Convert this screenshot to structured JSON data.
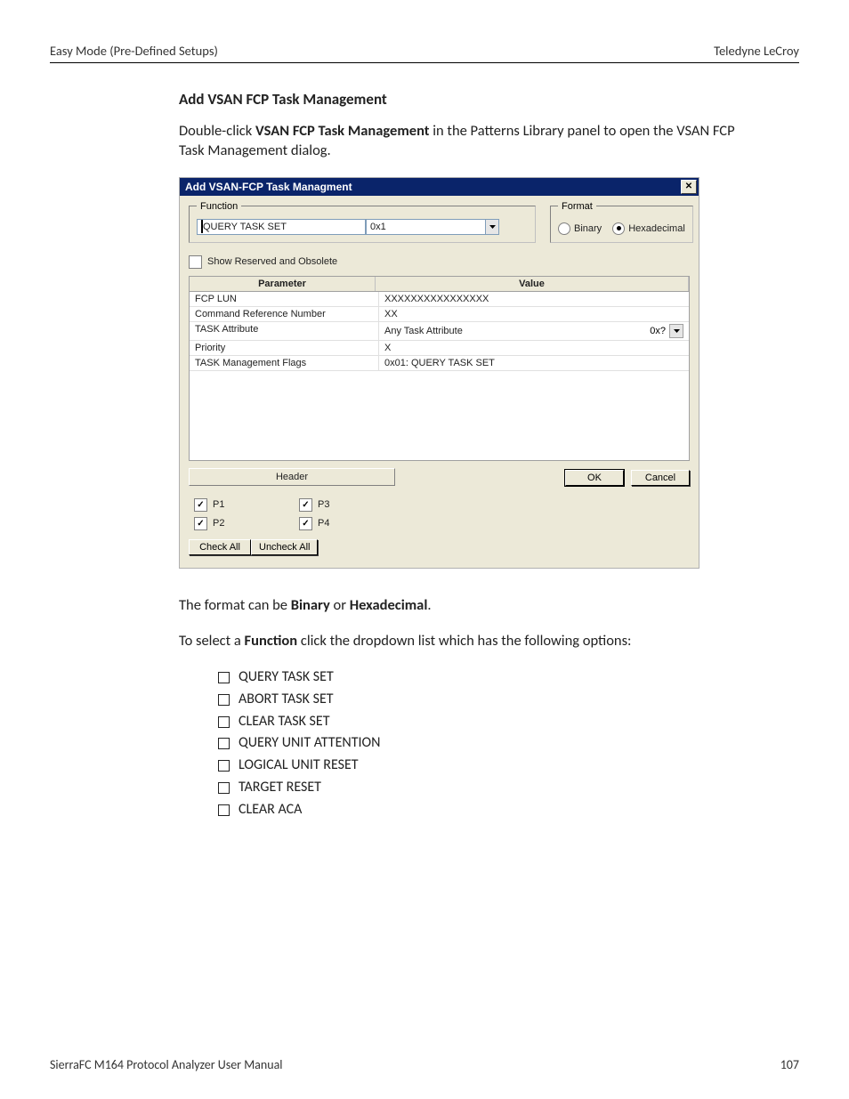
{
  "page_header": {
    "left": "Easy Mode (Pre-Defined Setups)",
    "right": "Teledyne LeCroy"
  },
  "section_title": "Add VSAN FCP Task Management",
  "intro": {
    "pre": "Double-click ",
    "bold": "VSAN FCP Task Management",
    "post": " in the Patterns Library panel to open the VSAN FCP Task Management dialog."
  },
  "dialog": {
    "title": "Add VSAN-FCP Task Managment",
    "function": {
      "legend": "Function",
      "selected": "QUERY TASK SET",
      "code": "0x1"
    },
    "format": {
      "legend": "Format",
      "binary": "Binary",
      "hex": "Hexadecimal",
      "selected": "hex"
    },
    "show_reserved_label": "Show Reserved and Obsolete",
    "grid": {
      "cols": {
        "param": "Parameter",
        "value": "Value"
      },
      "rows": [
        {
          "param": "FCP LUN",
          "value": "XXXXXXXXXXXXXXXX"
        },
        {
          "param": "Command Reference Number",
          "value": "XX"
        },
        {
          "param": "TASK Attribute",
          "value": "Any Task Attribute",
          "extra": "0x?",
          "has_dd": true
        },
        {
          "param": "Priority",
          "value": "X"
        },
        {
          "param": "TASK Management Flags",
          "value": "0x01: QUERY TASK SET"
        }
      ]
    },
    "header_btn": "Header",
    "ok": "OK",
    "cancel": "Cancel",
    "ports": {
      "p1": "P1",
      "p2": "P2",
      "p3": "P3",
      "p4": "P4"
    },
    "check_all": "Check All",
    "uncheck_all": "Uncheck All"
  },
  "format_sentence": {
    "pre": "The format can be ",
    "b1": "Binary",
    "mid": " or ",
    "b2": "Hexadecimal",
    "post": "."
  },
  "func_sentence": {
    "pre": "To select a ",
    "b": "Function",
    "post": " click the dropdown list which has the following options:"
  },
  "options": [
    "QUERY TASK SET",
    "ABORT TASK SET",
    "CLEAR TASK SET",
    "QUERY UNIT ATTENTION",
    "LOGICAL UNIT RESET",
    "TARGET RESET",
    "CLEAR ACA"
  ],
  "footer": {
    "left": "SierraFC M164 Protocol Analyzer User Manual",
    "right": "107"
  }
}
